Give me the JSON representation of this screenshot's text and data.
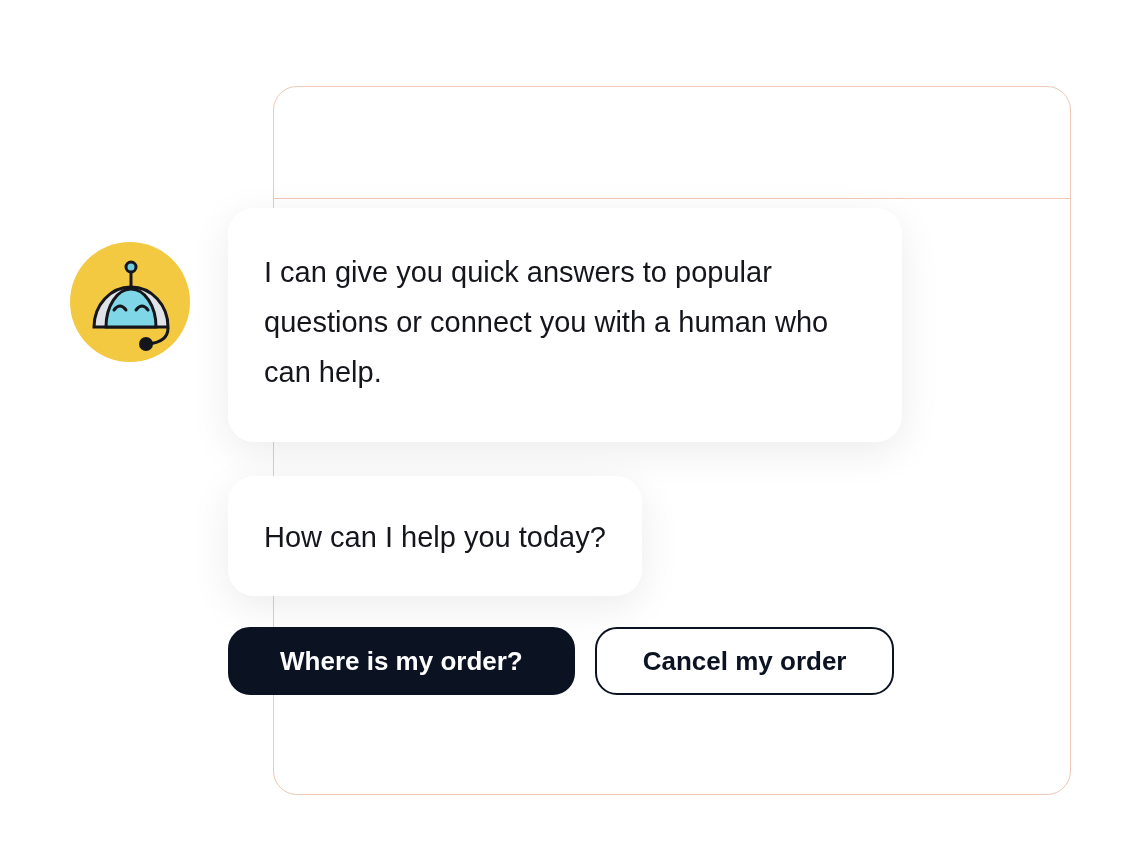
{
  "messages": [
    {
      "text": "I can give you quick answers to popular questions or connect you with a human who can help."
    },
    {
      "text": "How can I help you today?"
    }
  ],
  "quick_replies": [
    {
      "label": "Where is my order?",
      "selected": true
    },
    {
      "label": "Cancel my order",
      "selected": false
    }
  ]
}
